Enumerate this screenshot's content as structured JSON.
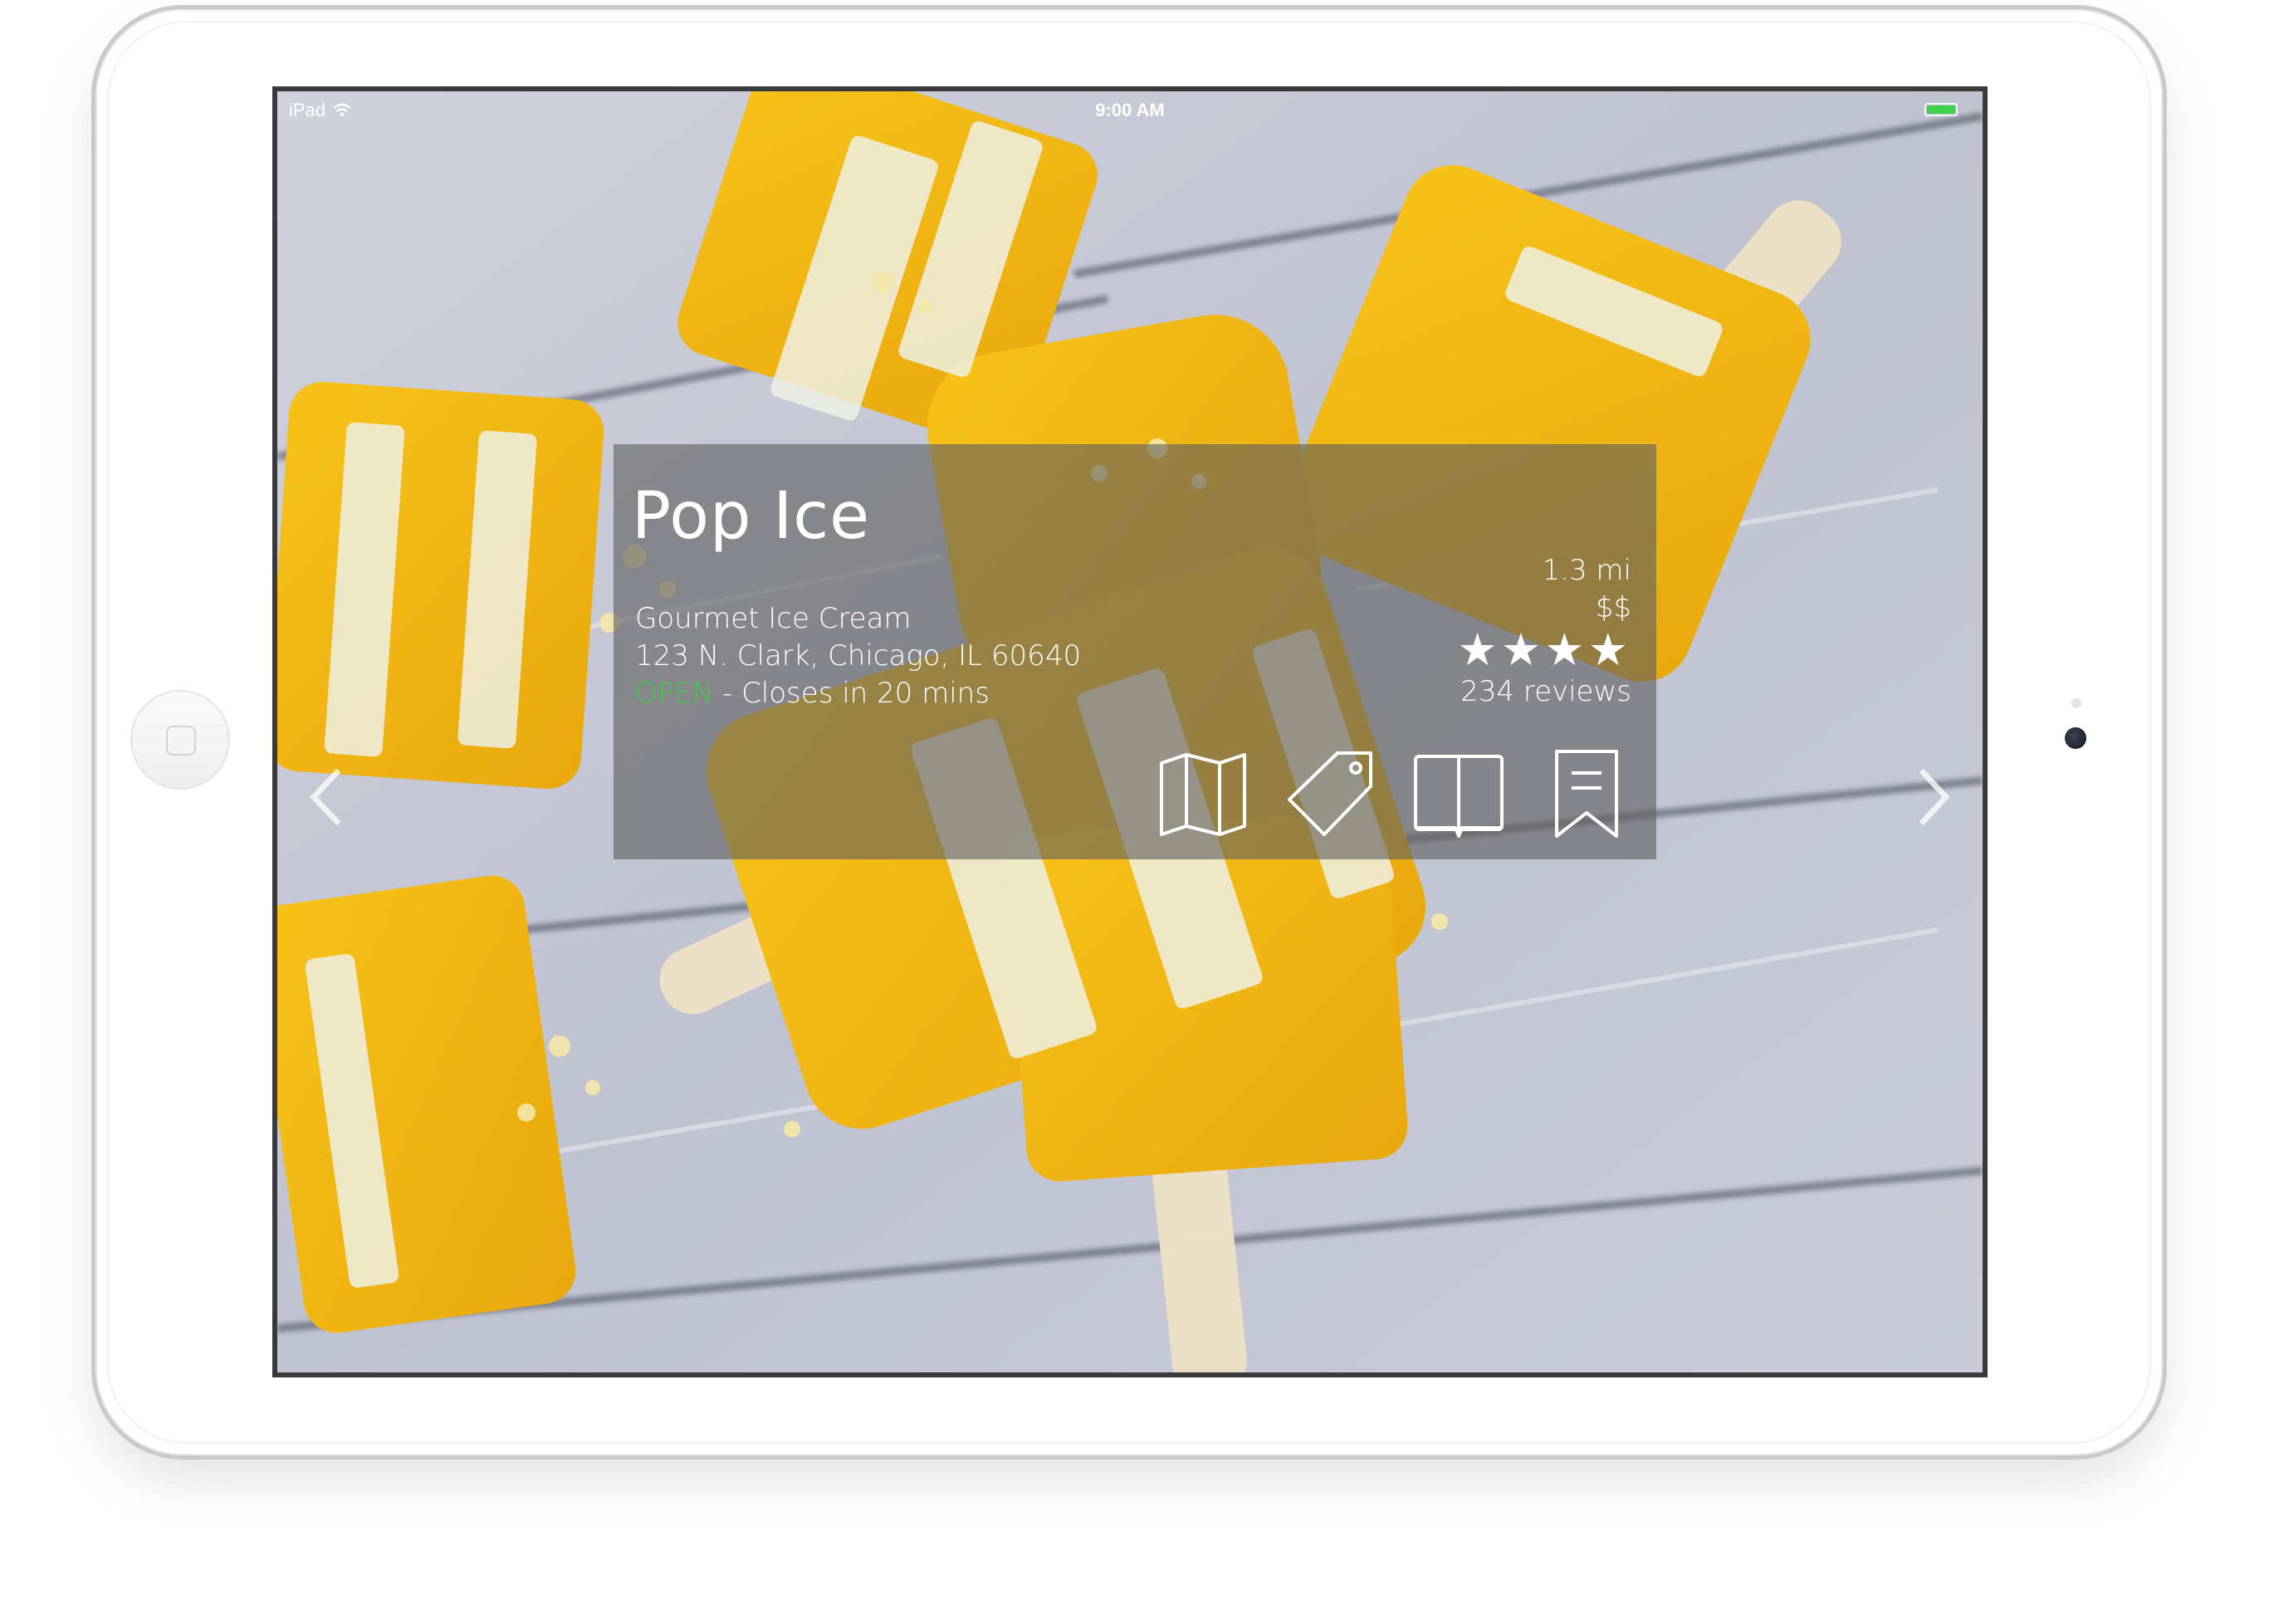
{
  "status_bar": {
    "device": "iPad",
    "time": "9:00 AM",
    "wifi_icon": "wifi-icon",
    "battery_icon": "battery-icon",
    "battery_color": "#3fd24a"
  },
  "navigation": {
    "prev_icon": "chevron-left-icon",
    "next_icon": "chevron-right-icon"
  },
  "place": {
    "name": "Pop Ice",
    "category": "Gourmet Ice Cream",
    "address": "123 N. Clark, Chicago, IL 60640",
    "open_label": "OPEN",
    "hours_text": " - Closes in 20 mins",
    "distance": "1.3 mi",
    "price": "$$",
    "rating_stars": 4,
    "stars_display": "★★★★",
    "reviews": "234 reviews"
  },
  "actions": [
    {
      "name": "map-button",
      "icon": "map-icon"
    },
    {
      "name": "deals-button",
      "icon": "tag-icon"
    },
    {
      "name": "menu-button",
      "icon": "book-icon"
    },
    {
      "name": "bookmark-button",
      "icon": "bookmark-icon"
    }
  ],
  "colors": {
    "open_status": "#3ecb47",
    "card_background": "rgba(96, 96, 96, 0.62)",
    "text": "#ffffff"
  }
}
